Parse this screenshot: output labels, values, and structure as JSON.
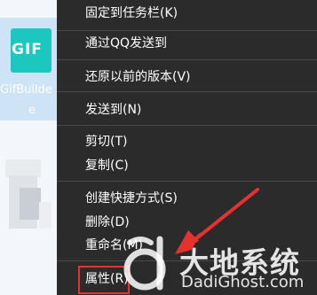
{
  "desktop": {
    "app_icon_text": "GIF",
    "app_label_line1": "GifBuilde",
    "app_label_line2": "e"
  },
  "context_menu": {
    "items": [
      {
        "label": "固定到任务栏(K)"
      },
      {
        "label": "通过QQ发送到"
      },
      {
        "label": "还原以前的版本(V)"
      },
      {
        "label": "发送到(N)"
      },
      {
        "label": "剪切(T)"
      },
      {
        "label": "复制(C)"
      },
      {
        "label": "创建快捷方式(S)"
      },
      {
        "label": "删除(D)"
      },
      {
        "label": "重命名(M)"
      },
      {
        "label": "属性(R)"
      }
    ],
    "highlighted_item": "属性(R)"
  },
  "watermark": {
    "chinese": "大地系统",
    "english": "DadiGhost.com"
  },
  "colors": {
    "menu_bg": "#2b2b2b",
    "highlight_border": "#e5322d",
    "arrow": "#e5322d",
    "app_tile": "#1bc7bf"
  }
}
